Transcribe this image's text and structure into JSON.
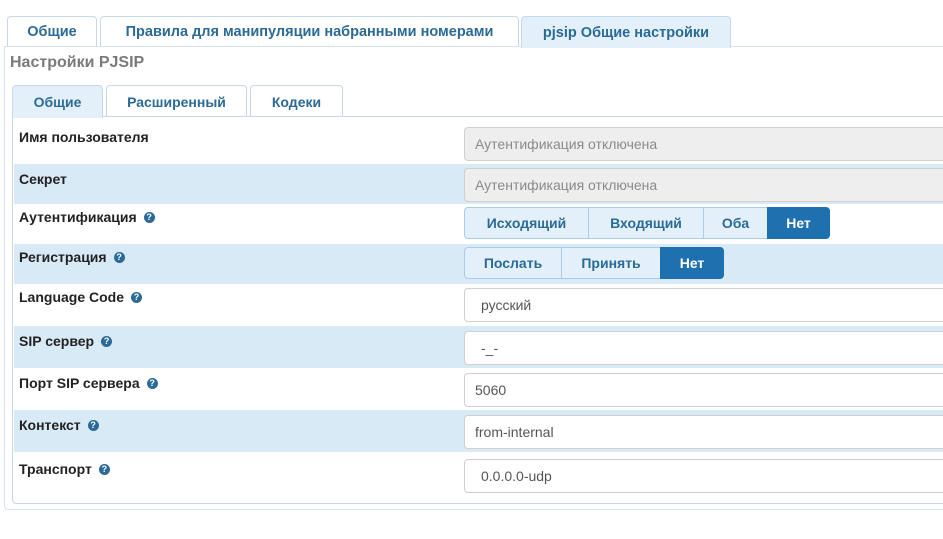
{
  "top_tabs": [
    {
      "label": "Общие",
      "active": false
    },
    {
      "label": "Правила для манипуляции набранными номерами",
      "active": false
    },
    {
      "label": "pjsip Общие настройки",
      "active": true
    }
  ],
  "panel_title": "Настройки PJSIP",
  "inner_tabs": [
    {
      "label": "Общие",
      "active": true
    },
    {
      "label": "Расширенный",
      "active": false
    },
    {
      "label": "Кодеки",
      "active": false
    }
  ],
  "help_glyph": "?",
  "fields": {
    "username": {
      "label": "Имя пользователя",
      "value": "Аутентификация отключена"
    },
    "secret": {
      "label": "Секрет",
      "value": "Аутентификация отключена"
    },
    "auth": {
      "label": "Аутентификация",
      "options": [
        "Исходящий",
        "Входящий",
        "Оба",
        "Нет"
      ],
      "selected": "Нет"
    },
    "registration": {
      "label": "Регистрация",
      "options": [
        "Послать",
        "Принять",
        "Нет"
      ],
      "selected": "Нет"
    },
    "language": {
      "label": "Language Code",
      "value": "русский"
    },
    "sip_server": {
      "label": "SIP сервер",
      "value": "-_-"
    },
    "sip_port": {
      "label": "Порт SIP сервера",
      "value": "5060"
    },
    "context": {
      "label": "Контекст",
      "value": "from-internal"
    },
    "transport": {
      "label": "Транспорт",
      "value": "0.0.0.0-udp"
    }
  },
  "colors": {
    "accent": "#2b6a96",
    "selected_segment": "#1f70ae",
    "alt_row": "#d9eaf7"
  }
}
